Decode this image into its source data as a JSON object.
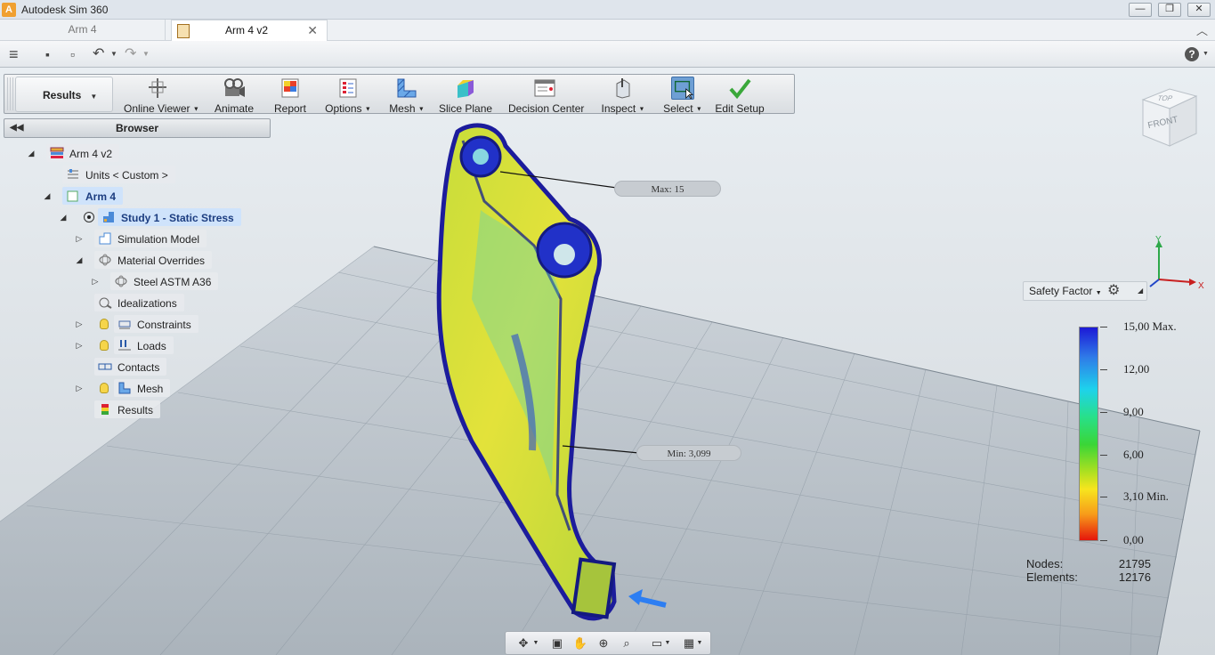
{
  "app": {
    "title": "Autodesk Sim 360",
    "icon": "autodesk-logo-icon"
  },
  "window_controls": {
    "minimize": "—",
    "restore": "❐",
    "close": "✕"
  },
  "tabs": [
    {
      "label": "Arm 4",
      "active": false
    },
    {
      "label": "Arm 4 v2",
      "active": true,
      "icon": "document-icon"
    }
  ],
  "toolbar_qat": {
    "menu": "≡",
    "save": "▪",
    "export": "▫",
    "undo": "↶",
    "redo": "↷",
    "help": "?"
  },
  "ribbon": {
    "workspace": "Results",
    "buttons": [
      {
        "label": "Online Viewer",
        "dropdown": true,
        "icon": "online-viewer-icon"
      },
      {
        "label": "Animate",
        "dropdown": false,
        "icon": "animate-icon"
      },
      {
        "label": "Report",
        "dropdown": false,
        "icon": "report-icon"
      },
      {
        "label": "Options",
        "dropdown": true,
        "icon": "options-icon"
      },
      {
        "label": "Mesh",
        "dropdown": true,
        "icon": "mesh-icon"
      },
      {
        "label": "Slice Plane",
        "dropdown": false,
        "icon": "slice-plane-icon"
      },
      {
        "label": "Decision Center",
        "dropdown": false,
        "icon": "decision-center-icon"
      },
      {
        "label": "Inspect",
        "dropdown": true,
        "icon": "inspect-icon"
      },
      {
        "label": "Select",
        "dropdown": true,
        "icon": "select-icon"
      },
      {
        "label": "Edit Setup",
        "dropdown": false,
        "icon": "checkmark-icon"
      }
    ]
  },
  "browser": {
    "title": "Browser",
    "tree": [
      {
        "label": "Arm 4 v2",
        "expander": "◢"
      },
      {
        "label": "Units < Custom >"
      },
      {
        "label": "Arm 4",
        "expander": "◢",
        "selected": true
      },
      {
        "label": "Study 1 - Static Stress",
        "expander": "◢",
        "selected": true
      },
      {
        "label": "Simulation Model",
        "expander": "▷"
      },
      {
        "label": "Material Overrides",
        "expander": "◢"
      },
      {
        "label": "Steel ASTM A36",
        "expander": "▷"
      },
      {
        "label": "Idealizations"
      },
      {
        "label": "Constraints",
        "expander": "▷"
      },
      {
        "label": "Loads",
        "expander": "▷"
      },
      {
        "label": "Contacts"
      },
      {
        "label": "Mesh",
        "expander": "▷"
      },
      {
        "label": "Results"
      }
    ]
  },
  "viewport": {
    "callout_max": "Max: 15",
    "callout_min": "Min: 3,099",
    "viewcube": {
      "top": "TOP",
      "front": "FRONT"
    },
    "triad": {
      "x": "X",
      "y": "Y"
    }
  },
  "legend": {
    "result_type": "Safety Factor",
    "labels": [
      "15,00 Max.",
      "12,00",
      "9,00",
      "6,00",
      "3,10 Min.",
      "0,00"
    ],
    "colors": {
      "max": "#1c19d6",
      "mid": "#3ad637",
      "min": "#e5160c"
    }
  },
  "stats": {
    "nodes_label": "Nodes:",
    "nodes_value": "21795",
    "elements_label": "Elements:",
    "elements_value": "12176"
  },
  "navbar": {
    "orbit": "✥",
    "look_at": "▣",
    "pan": "✋",
    "zoom": "⊕",
    "fit": "⌕",
    "display": "▭",
    "grid": "▦"
  }
}
